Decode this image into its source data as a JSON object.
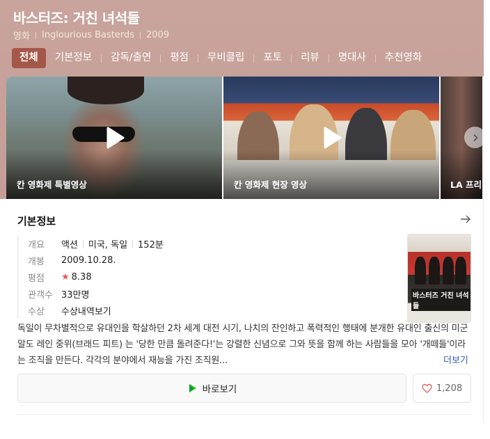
{
  "header": {
    "title": "바스터즈: 거친 녀석들",
    "meta": [
      "영화",
      "Inglourious Basterds",
      "2009"
    ],
    "tabs": [
      {
        "label": "전체",
        "active": true
      },
      {
        "label": "기본정보"
      },
      {
        "label": "감독/출연"
      },
      {
        "label": "평점"
      },
      {
        "label": "무비클립"
      },
      {
        "label": "포토"
      },
      {
        "label": "리뷰"
      },
      {
        "label": "명대사"
      },
      {
        "label": "추천영화"
      }
    ]
  },
  "videos": [
    {
      "title": "칸 영화제 특별영상",
      "icon": "play-icon"
    },
    {
      "title": "칸 영화제 현장 영상",
      "icon": "play-icon"
    },
    {
      "title": "LA 프리"
    }
  ],
  "basic_info": {
    "section_title": "기본정보",
    "rows": {
      "overview": {
        "label": "개요",
        "genre": "액션",
        "country": "미국, 독일",
        "runtime": "152분"
      },
      "release": {
        "label": "개봉",
        "value": "2009.10.28."
      },
      "rating": {
        "label": "평점",
        "star": "★",
        "value": "8.38"
      },
      "audience": {
        "label": "관객수",
        "value": "33만명"
      },
      "awards": {
        "label": "수상",
        "value": "수상내역보기"
      }
    },
    "poster": {
      "title_text": "바스터즈 거친 녀석들"
    },
    "synopsis": "독일이 무차별적으로 유대인을 학살하던 2차 세계 대전 시기, 나치의 잔인하고 폭력적인 행태에 분개한 유대인 출신의 미군 알도 레인 중위(브래드 피트) 는 '당한 만큼 돌려준다!'는 강렬한 신념으로 그와 뜻을 함께 하는 사람들을 모아 '개떼들'이라는 조직을 만든다. 각각의 분야에서 재능을 가진 조직원...",
    "more_label": "더보기",
    "watch_label": "바로보기",
    "like_count": "1,208"
  },
  "colors": {
    "header_bg": "#c6a19a",
    "active_tab": "#a4584a",
    "link": "#2e5dbf",
    "star": "#ef5656"
  }
}
